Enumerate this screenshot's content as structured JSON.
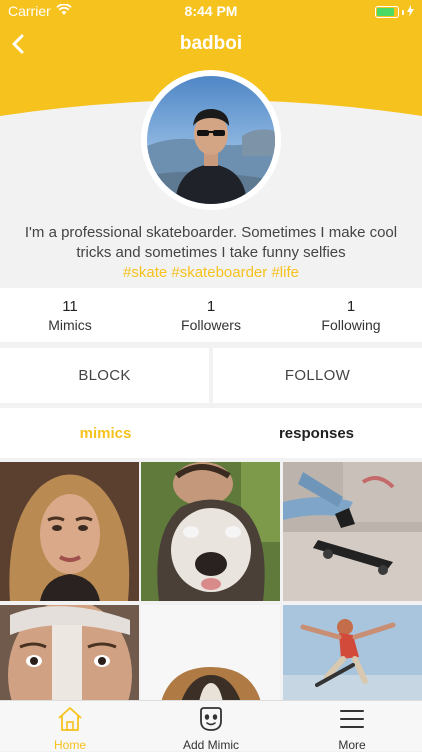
{
  "status_bar": {
    "carrier": "Carrier",
    "time": "8:44 PM"
  },
  "nav": {
    "title": "badboi"
  },
  "profile": {
    "bio_line1": "I'm a professional skateboarder. Sometimes I make cool",
    "bio_line2": "tricks and sometimes I take funny selfies",
    "hashtags": "#skate #skateboarder #life"
  },
  "stats": [
    {
      "value": "11",
      "label": "Mimics"
    },
    {
      "value": "1",
      "label": "Followers"
    },
    {
      "value": "1",
      "label": "Following"
    }
  ],
  "actions": {
    "block_label": "BLOCK",
    "follow_label": "FOLLOW"
  },
  "tabs": {
    "mimics_label": "mimics",
    "responses_label": "responses"
  },
  "tabbar": {
    "home_label": "Home",
    "add_label": "Add Mimic",
    "more_label": "More"
  },
  "colors": {
    "accent": "#f6c21e",
    "battery": "#4cd964",
    "background": "#f2f2f2"
  }
}
